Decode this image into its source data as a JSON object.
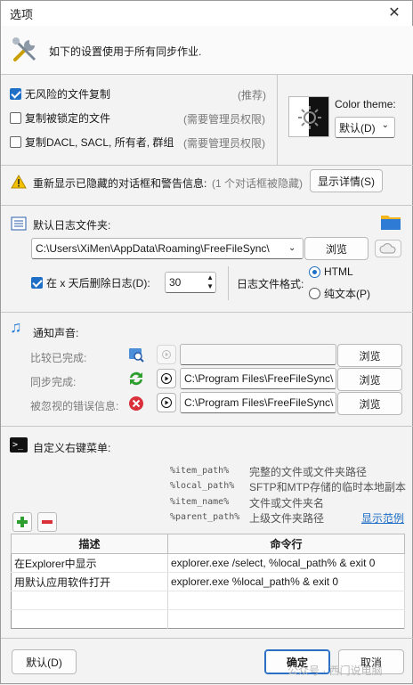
{
  "window": {
    "title": "选项",
    "close_glyph": "✕"
  },
  "header": {
    "description": "如下的设置使用于所有同步作业."
  },
  "options": {
    "items": [
      {
        "label": "无风险的文件复制",
        "hint": "(推荐)",
        "checked": true
      },
      {
        "label": "复制被锁定的文件",
        "hint": "(需要管理员权限)",
        "checked": false
      },
      {
        "label": "复制DACL, SACL, 所有者, 群组",
        "hint": "(需要管理员权限)",
        "checked": false
      }
    ],
    "color_theme_label": "Color theme:",
    "color_theme_value": "默认(D)"
  },
  "warnings": {
    "text": "重新显示已隐藏的对话框和警告信息:",
    "count_text": "(1 个对话框被隐藏)",
    "button": "显示详情(S)"
  },
  "log": {
    "title": "默认日志文件夹:",
    "path": "C:\\Users\\XiMen\\AppData\\Roaming\\FreeFileSync\\",
    "browse": "浏览",
    "delete_label": "在 x 天后删除日志(D):",
    "delete_checked": true,
    "days": "30",
    "format_label": "日志文件格式:",
    "format_html": "HTML",
    "format_text": "纯文本(P)",
    "selected_format": "HTML"
  },
  "sounds": {
    "title": "通知声音:",
    "rows": [
      {
        "label": "比较已完成:",
        "path": "",
        "browse": "浏览",
        "enabled": false
      },
      {
        "label": "同步完成:",
        "path": "C:\\Program Files\\FreeFileSync\\",
        "browse": "浏览",
        "enabled": true
      },
      {
        "label": "被忽视的错误信息:",
        "path": "C:\\Program Files\\FreeFileSync\\",
        "browse": "浏览",
        "enabled": true
      }
    ]
  },
  "context_menu": {
    "title": "自定义右键菜单:",
    "macros": [
      {
        "name": "%item_path%",
        "desc": "完整的文件或文件夹路径"
      },
      {
        "name": "%local_path%",
        "desc": "SFTP和MTP存储的临时本地副本"
      },
      {
        "name": "%item_name%",
        "desc": "文件或文件夹名"
      },
      {
        "name": "%parent_path%",
        "desc": "上级文件夹路径"
      }
    ],
    "show_examples": "显示范例",
    "columns": [
      "描述",
      "命令行"
    ],
    "rows": [
      [
        "在Explorer中显示",
        "explorer.exe /select, %local_path% & exit 0"
      ],
      [
        "用默认应用软件打开",
        "explorer.exe %local_path% & exit 0"
      ]
    ]
  },
  "footer": {
    "default": "默认(D)",
    "ok": "确定",
    "cancel": "取消"
  },
  "watermark": "公众号 · 西门说电脑",
  "colors": {
    "accent": "#1f6fc6",
    "warning": "#f2c200",
    "error": "#d9303a",
    "success": "#2e9e2e"
  }
}
